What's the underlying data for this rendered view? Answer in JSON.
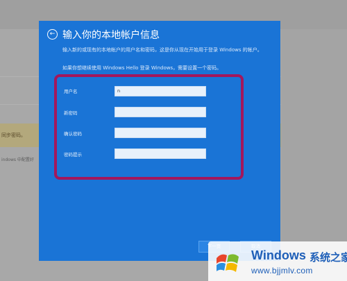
{
  "background": {
    "warning_text": "同步密码。",
    "line_text": "indows 中配置好"
  },
  "dialog": {
    "back_icon": "arrow-left-icon",
    "title": "输入你的本地帐户信息",
    "description": "输入新的或现有的本地帐户的用户名和密码，这是你从现在开始用于登录 Windows 的帐户。",
    "hello_note": "如果你想继续使用 Windows Hello 登录 Windows，需要设置一个密码。",
    "fields": [
      {
        "label": "用户名",
        "value": "n"
      },
      {
        "label": "新密码",
        "value": ""
      },
      {
        "label": "确认密码",
        "value": ""
      },
      {
        "label": "密码提示",
        "value": ""
      }
    ],
    "next_button": "下一页",
    "cancel_button": "取消"
  },
  "watermark": {
    "title": "Windows",
    "title_cn": "系统之家",
    "url": "www.bjjmlv.com"
  },
  "colors": {
    "dialog_bg": "#1a74d6",
    "highlight": "#a3175c",
    "watermark_blue": "#1e5fb8"
  }
}
